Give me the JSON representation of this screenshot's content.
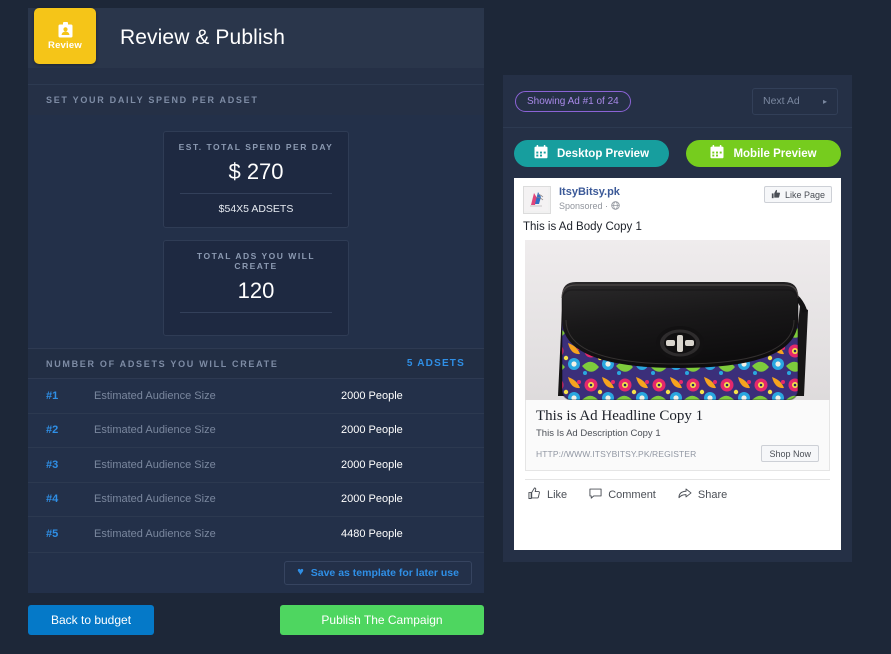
{
  "theme": {
    "page_bg": "#1d2738",
    "panel_bg": "#253046",
    "accent_yellow": "#f5c518",
    "accent_blue": "#2f8fe6",
    "accent_green": "#4ed660",
    "accent_teal": "#179e9e",
    "accent_lime": "#76cc1e",
    "accent_purple": "#a889e8",
    "button_blue": "#0579c8"
  },
  "left_panel": {
    "step_badge": {
      "icon": "id-badge-icon",
      "label": "Review"
    },
    "title": "Review & Publish",
    "section_caption": "SET YOUR DAILY SPEND PER ADSET",
    "spend_card": {
      "label": "EST. TOTAL SPEND PER DAY",
      "value": "$ 270",
      "sub": "$54X5 ADSETS"
    },
    "ads_card": {
      "label": "TOTAL ADS YOU WILL CREATE",
      "value": "120"
    },
    "adsets": {
      "header": "NUMBER OF ADSETS YOU WILL CREATE",
      "count_label": "5 ADSETS",
      "rows": [
        {
          "num": "#1",
          "label": "Estimated Audience Size",
          "value": "2000 People"
        },
        {
          "num": "#2",
          "label": "Estimated Audience Size",
          "value": "2000 People"
        },
        {
          "num": "#3",
          "label": "Estimated Audience Size",
          "value": "2000 People"
        },
        {
          "num": "#4",
          "label": "Estimated Audience Size",
          "value": "2000 People"
        },
        {
          "num": "#5",
          "label": "Estimated Audience Size",
          "value": "4480 People"
        }
      ]
    },
    "save_template": {
      "icon": "heart-icon",
      "label": "Save as template for later use",
      "glyph": "♥"
    },
    "actions": {
      "back": "Back to budget",
      "publish": "Publish The Campaign"
    }
  },
  "right_panel": {
    "ad_counter": "Showing Ad #1 of 24",
    "next_ad": {
      "label": "Next Ad",
      "arrow": "▸"
    },
    "preview_toggles": [
      {
        "label": "Desktop Preview",
        "icon": "calendar-icon",
        "active": false
      },
      {
        "label": "Mobile Preview",
        "icon": "calendar-icon",
        "active": true
      }
    ],
    "ad": {
      "avatar": "page-avatar",
      "page_name": "ItsyBitsy.pk",
      "sponsored": "Sponsored ·",
      "globe_icon": "globe-icon",
      "like_page": {
        "label": "Like Page",
        "icon": "thumbs-up-icon"
      },
      "body_copy": "This is Ad Body Copy 1",
      "image": "handbag-product-photo",
      "headline": "This is Ad Headline Copy 1",
      "description": "This Is Ad Description Copy 1",
      "url": "HTTP://WWW.ITSYBITSY.PK/REGISTER",
      "cta": "Shop Now",
      "actions": [
        {
          "label": "Like",
          "icon": "thumbs-up-icon"
        },
        {
          "label": "Comment",
          "icon": "comment-icon"
        },
        {
          "label": "Share",
          "icon": "share-icon"
        }
      ]
    }
  }
}
